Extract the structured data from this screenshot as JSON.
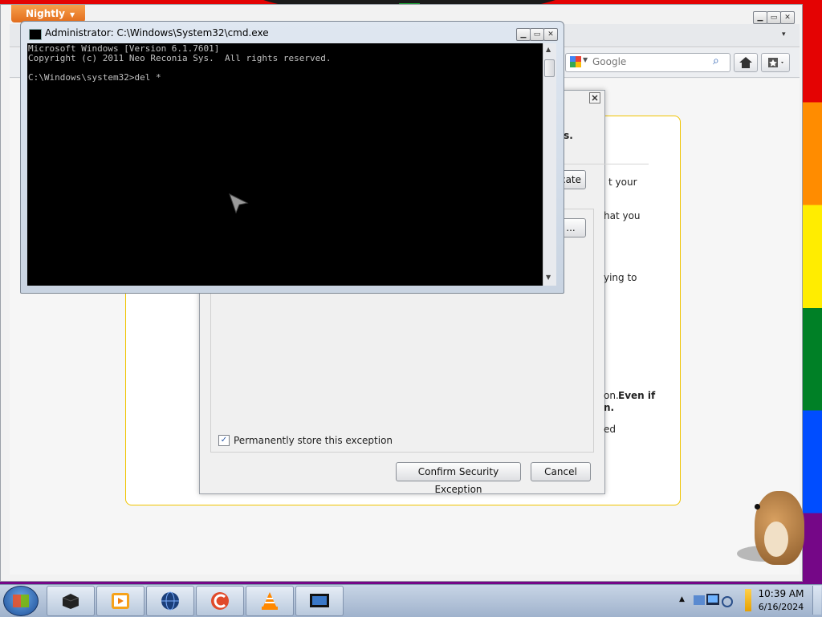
{
  "browser": {
    "app_button": "Nightly",
    "search_engine": "Google",
    "search_placeholder": "Google"
  },
  "exception_dialog": {
    "fragments": [
      "is.",
      "cate",
      "t your",
      "hat you",
      "...",
      "ying to",
      "on.",
      "Even if",
      "n.",
      "ed"
    ],
    "permanent_label": "Permanently store this exception",
    "permanent_checked": true,
    "confirm_label": "Confirm Security Exception",
    "cancel_label": "Cancel"
  },
  "cmd": {
    "title": "Administrator: C:\\Windows\\System32\\cmd.exe",
    "lines": [
      "Microsoft Windows [Version 6.1.7601]",
      "Copyright (c) 2011 Neo Reconia Sys.  All rights reserved.",
      "",
      "C:\\Windows\\system32>del *"
    ]
  },
  "taskbar": {
    "apps": [
      "cmd-icon",
      "media-player-icon",
      "globe-icon",
      "ccleaner-icon",
      "vlc-icon",
      "monitor-icon"
    ],
    "clock_time": "10:39 AM",
    "clock_date": "6/16/2024"
  },
  "colors": {
    "accent_yellow": "#f0c400",
    "console_bg": "#000000",
    "console_text": "#c0c0c0"
  }
}
